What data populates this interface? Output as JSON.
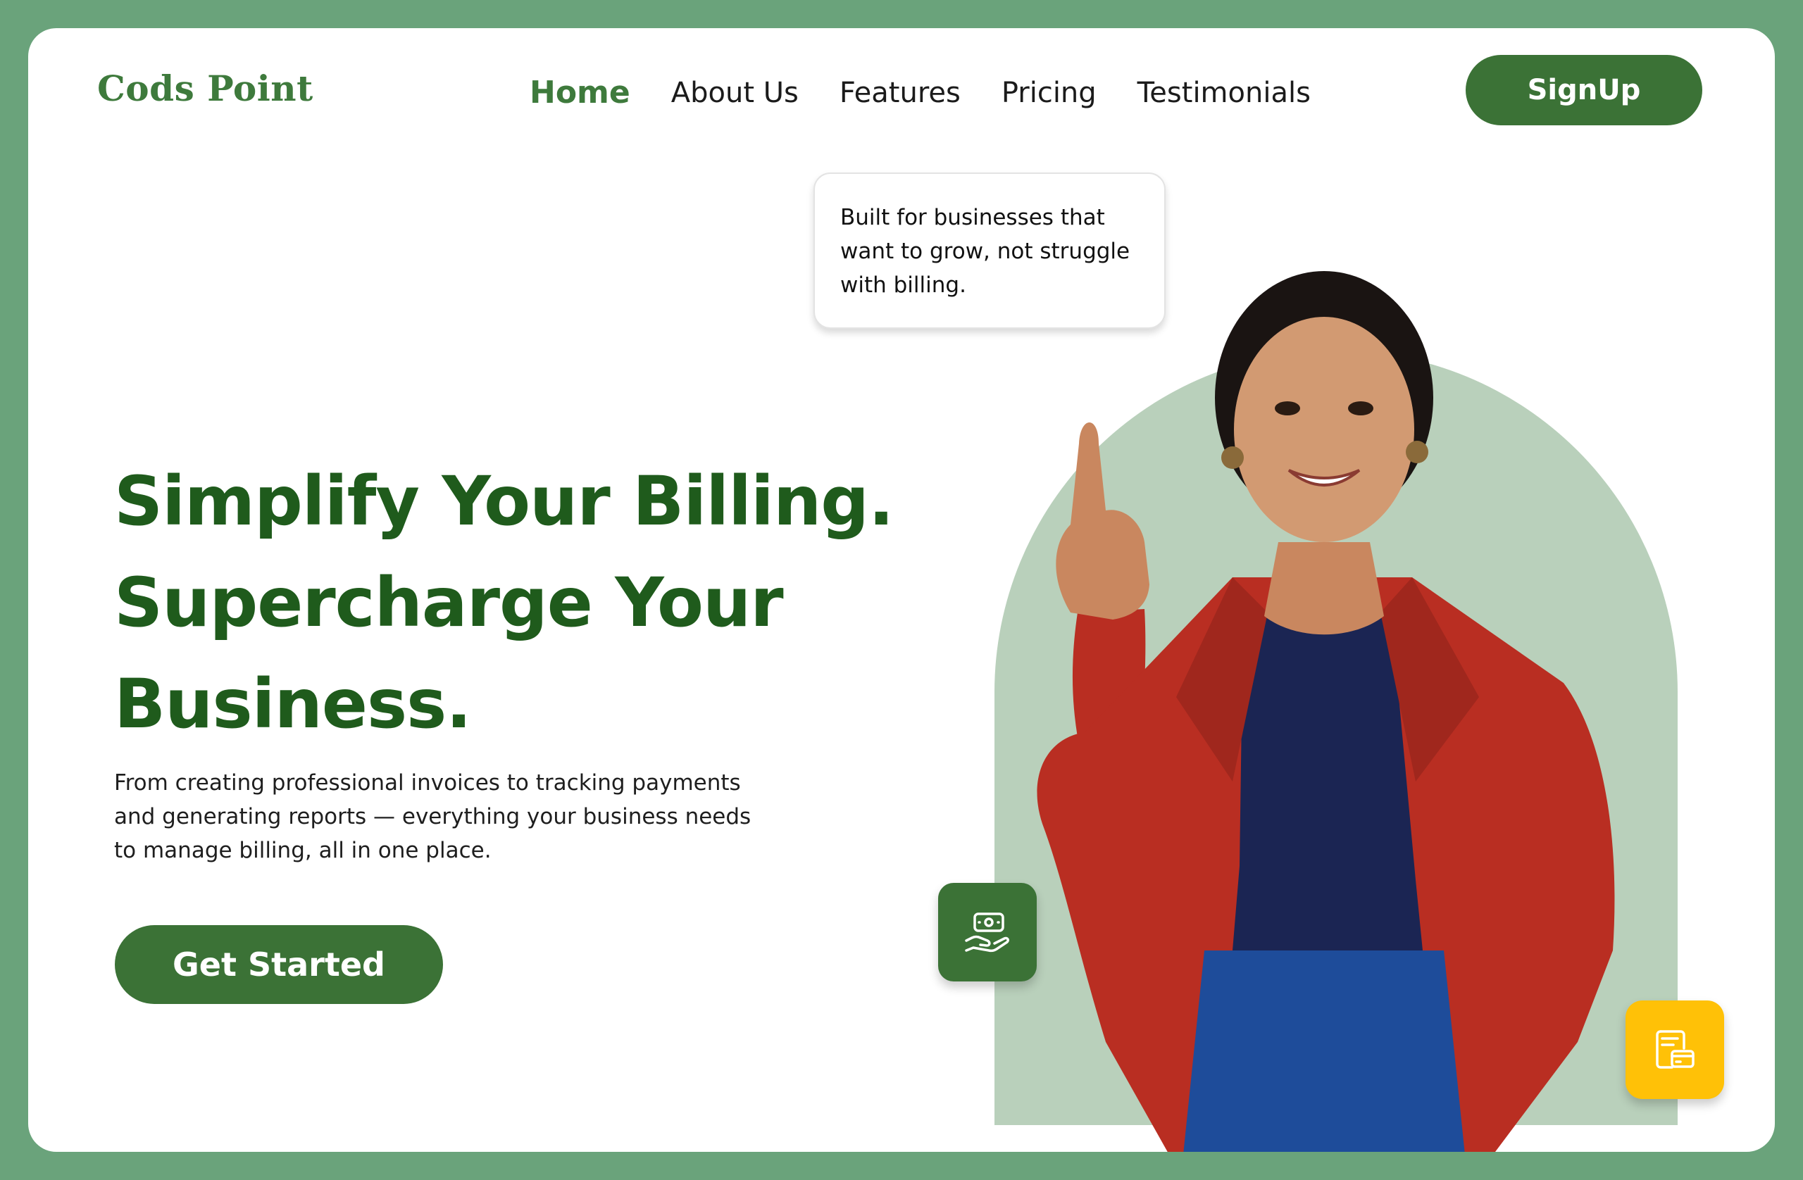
{
  "brand": {
    "name": "Cods Point"
  },
  "nav": {
    "items": [
      {
        "label": "Home",
        "active": true
      },
      {
        "label": "About Us",
        "active": false
      },
      {
        "label": "Features",
        "active": false
      },
      {
        "label": "Pricing",
        "active": false
      },
      {
        "label": "Testimonials",
        "active": false
      }
    ],
    "signup_label": "SignUp"
  },
  "hero": {
    "headline_lines": [
      "Simplify Your Billing.",
      "Supercharge Your",
      "Business."
    ],
    "subtext": "From creating professional invoices to tracking payments and generating reports — everything your business needs to manage billing, all in one place.",
    "cta_label": "Get Started"
  },
  "quote_card": {
    "text": "Built for businesses that want to grow, not struggle with billing."
  },
  "icons": {
    "money_tile": "money-hand-icon",
    "invoice_tile": "invoice-card-icon"
  },
  "colors": {
    "brand_green": "#3b7236",
    "heading_green": "#1f5b1c",
    "frame_green": "#6aa37b",
    "arch_green": "#b9d0bb",
    "accent_yellow": "#ffc107",
    "blazer_red": "#b92e22"
  }
}
